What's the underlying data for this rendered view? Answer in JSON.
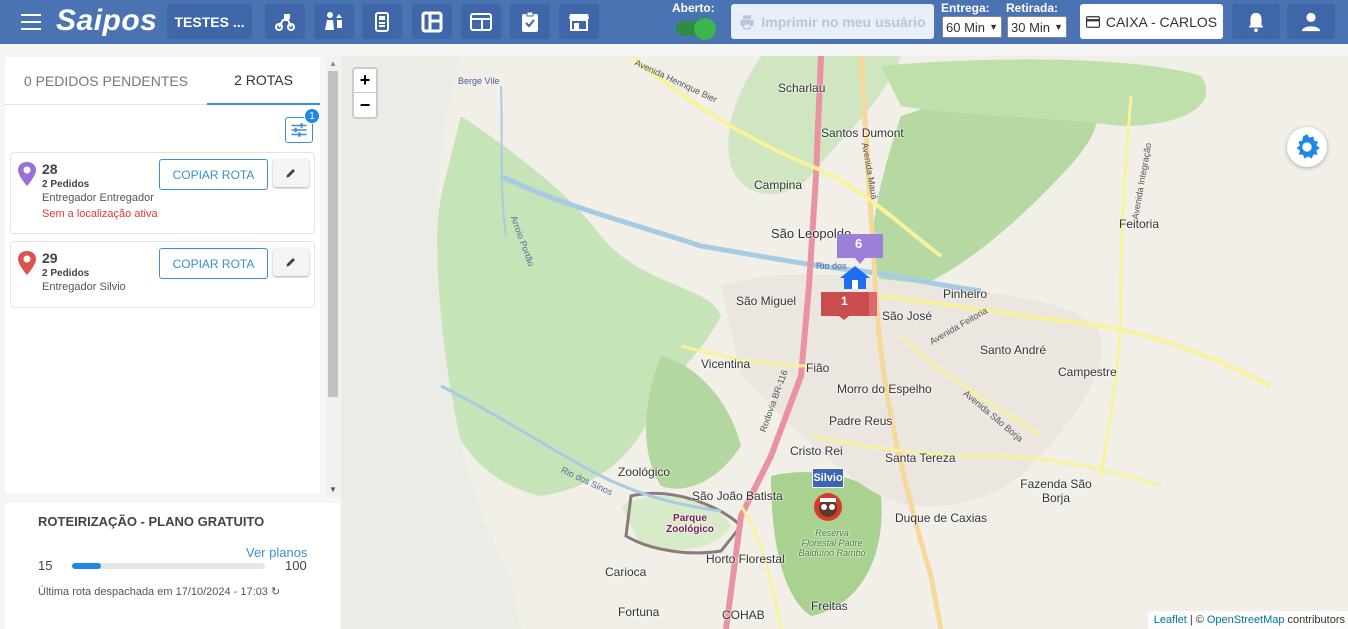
{
  "app": {
    "logo": "Saipos",
    "store": "TESTES ..."
  },
  "toolbar": {
    "icons": [
      "delivery-icon",
      "handoff-icon",
      "cashier-icon",
      "kanban-icon",
      "screen-icon",
      "checklist-icon",
      "store-icon"
    ],
    "aberto_label": "Aberto:",
    "aberto_on": true,
    "print_label": "Imprimir no meu usuário",
    "entrega_label": "Entrega:",
    "entrega_value": "60 Min",
    "retirada_label": "Retirada:",
    "retirada_value": "30 Min",
    "caixa_label": "CAIXA - CARLOS"
  },
  "tabs": [
    {
      "label": "0 PEDIDOS PENDENTES",
      "active": false
    },
    {
      "label": "2 ROTAS",
      "active": true
    }
  ],
  "filter_badge": "1",
  "routes": [
    {
      "number": "28",
      "orders": "2 Pedidos",
      "driver": "Entregador Entregador",
      "warning": "Sem a localização ativa",
      "pin_color": "#9b6fd6",
      "copy_label": "COPIAR ROTA"
    },
    {
      "number": "29",
      "orders": "2 Pedidos",
      "driver": "Entregador Silvio",
      "warning": "",
      "pin_color": "#d9534f",
      "copy_label": "COPIAR ROTA"
    }
  ],
  "plan": {
    "title": "ROTEIRIZAÇÃO - PLANO GRATUITO",
    "link": "Ver planos",
    "min": "15",
    "max": "100",
    "progress": 0.15,
    "last_route": "Última rota despachada em 17/10/2024 - 17:03"
  },
  "map": {
    "zoom_in": "+",
    "zoom_out": "−",
    "places": [
      "Scharlau",
      "Santos Dumont",
      "Campina",
      "São Leopoldo",
      "Feitoria",
      "São Miguel",
      "Pinheiro",
      "São José",
      "Santo André",
      "Campestre",
      "Vicentina",
      "Fião",
      "Morro do Espelho",
      "Padre Reus",
      "Cristo Rei",
      "Santa Tereza",
      "Zoológico",
      "São João Batista",
      "Duque de Caxias",
      "Fazenda São Borja",
      "Horto Florestal",
      "Carioca",
      "Fortuna",
      "COHAB",
      "Freitas",
      "Berge Vile"
    ],
    "park_label": "Parque Zoológico",
    "reserve_label": "Reserva Florestal Padre Balduíno Rambo",
    "roads": [
      "Avenida Henrique Bier",
      "Avenida Mauá",
      "Avenida Integração",
      "Rodovia BR-116",
      "Avenida Feitoria",
      "Avenida São Borja",
      "Arroio Portão",
      "Rio dos Sinos",
      "Rio dos"
    ],
    "markers": {
      "cluster_6": "6",
      "route_1": "1",
      "driver_tag": "Silvio"
    },
    "attribution": {
      "leaflet": "Leaflet",
      "sep": "| ©",
      "osm": "OpenStreetMap",
      "contrib": "contributors"
    }
  },
  "colors": {
    "topbar": "#4a73b4",
    "accent": "#3a8fd6",
    "toggle_on": "#3cb54d"
  }
}
